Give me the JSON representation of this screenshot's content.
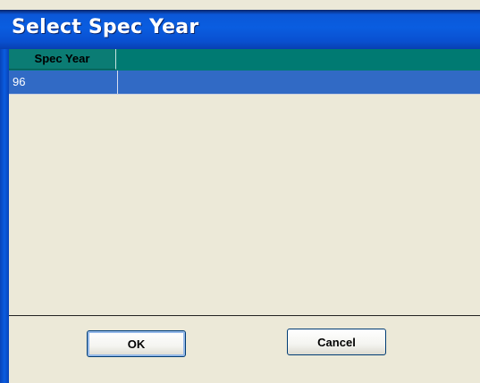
{
  "dialog": {
    "title": "Select Spec Year"
  },
  "grid": {
    "columns": [
      "Spec Year"
    ],
    "rows": [
      {
        "spec_year": "96",
        "selected": true
      }
    ]
  },
  "buttons": {
    "ok_label": "OK",
    "cancel_label": "Cancel"
  },
  "colors": {
    "title_bar": "#0a5de0",
    "header": "#007a72",
    "selection": "#316ac5",
    "background": "#ece9d8"
  }
}
